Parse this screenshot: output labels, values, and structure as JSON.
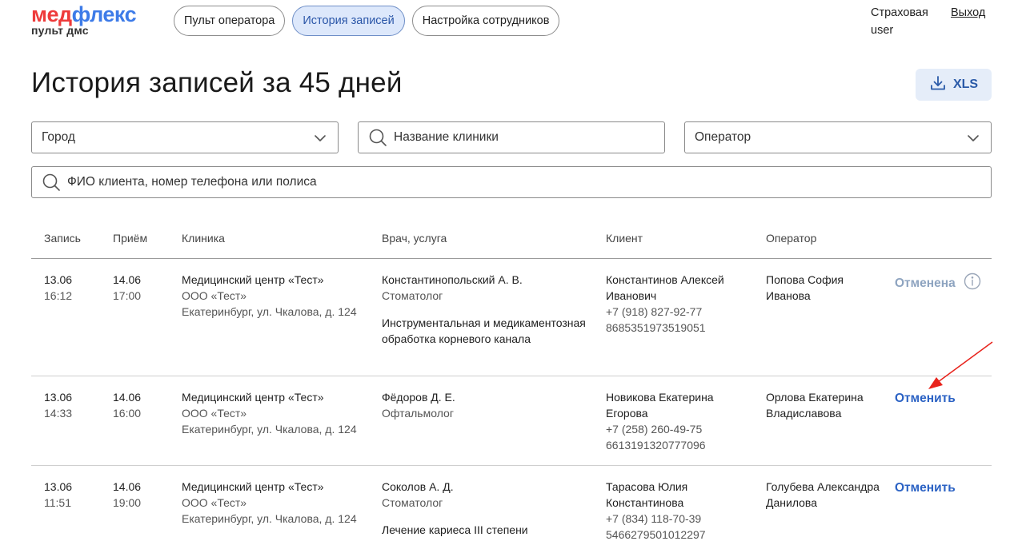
{
  "logo": {
    "part1": "мед",
    "part2": "флекс",
    "subtitle": "пульт дмс"
  },
  "nav": [
    {
      "label": "Пульт оператора",
      "active": false
    },
    {
      "label": "История записей",
      "active": true
    },
    {
      "label": "Настройка сотрудников",
      "active": false
    }
  ],
  "user": {
    "line1": "Страховая",
    "line2": "user",
    "logout": "Выход"
  },
  "page_title": "История записей за 45 дней",
  "export": {
    "label": "XLS"
  },
  "filters": {
    "city_placeholder": "Город",
    "clinic_placeholder": "Название клиники",
    "operator_placeholder": "Оператор",
    "client_placeholder": "ФИО клиента, номер телефона или полиса"
  },
  "table": {
    "headers": [
      "Запись",
      "Приём",
      "Клиника",
      "Врач, услуга",
      "Клиент",
      "Оператор"
    ],
    "rows": [
      {
        "booked_date": "13.06",
        "booked_time": "16:12",
        "visit_date": "14.06",
        "visit_time": "17:00",
        "clinic_name": "Медицинский центр «Тест»",
        "clinic_org": "ООО «Тест»",
        "clinic_address": "Екатеринбург, ул. Чкалова, д. 124",
        "doctor": "Константинопольский А. В.",
        "specialty": "Стоматолог",
        "service": "Инструментальная и медикаментозная обработка корневого канала",
        "client_name": "Константинов Алексей Иванович",
        "client_phone": "+7 (918) 827-92-77",
        "client_policy": "8685351973519051",
        "operator": "Попова София Иванова",
        "action": "Отменена",
        "status": "canceled"
      },
      {
        "booked_date": "13.06",
        "booked_time": "14:33",
        "visit_date": "14.06",
        "visit_time": "16:00",
        "clinic_name": "Медицинский центр «Тест»",
        "clinic_org": "ООО «Тест»",
        "clinic_address": "Екатеринбург, ул. Чкалова, д. 124",
        "doctor": "Фёдоров Д. Е.",
        "specialty": "Офтальмолог",
        "service": "",
        "client_name": "Новикова Екатерина Егорова",
        "client_phone": "+7 (258) 260-49-75",
        "client_policy": "6613191320777096",
        "operator": "Орлова Екатерина Владиславова",
        "action": "Отменить",
        "status": "active"
      },
      {
        "booked_date": "13.06",
        "booked_time": "11:51",
        "visit_date": "14.06",
        "visit_time": "19:00",
        "clinic_name": "Медицинский центр «Тест»",
        "clinic_org": "ООО «Тест»",
        "clinic_address": "Екатеринбург, ул. Чкалова, д. 124",
        "doctor": "Соколов А. Д.",
        "specialty": "Стоматолог",
        "service": "Лечение кариеса III степени",
        "client_name": "Тарасова Юлия Константинова",
        "client_phone": "+7 (834) 118-70-39",
        "client_policy": "5466279501012297",
        "operator": "Голубева Александра Данилова",
        "action": "Отменить",
        "status": "active"
      }
    ]
  },
  "colors": {
    "accent": "#2b62c4",
    "brand_red": "#ee3b3b",
    "brand_blue": "#3d7be8",
    "canceled": "#8ea4c0",
    "annotation_arrow": "#e8231c"
  }
}
